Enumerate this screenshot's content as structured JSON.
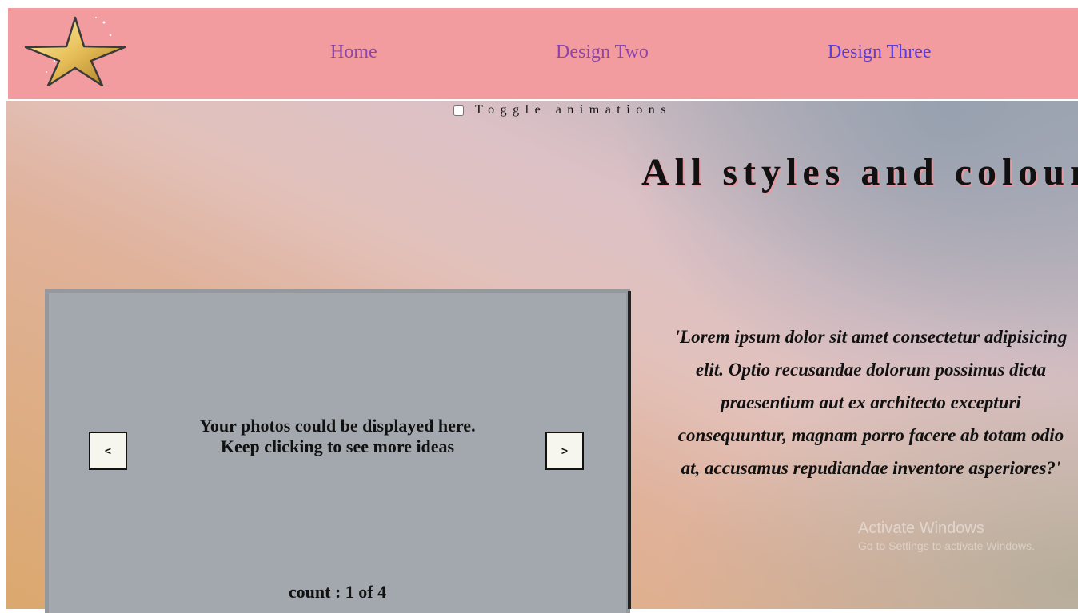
{
  "header": {
    "logo": "gold-star-logo",
    "nav": [
      {
        "label": "Home"
      },
      {
        "label": "Design Two"
      },
      {
        "label": "Design Three"
      }
    ]
  },
  "toggle": {
    "label": "Toggle animations",
    "checked": false
  },
  "headline": "All styles and colour",
  "slider": {
    "caption_line1": "Your photos could be displayed here.",
    "caption_line2": "Keep clicking to see more ideas",
    "prev_label": "<",
    "next_label": ">",
    "count": "count : 1 of 4"
  },
  "quote": "'Lorem ipsum dolor sit amet consectetur adipisicing elit. Optio recusandae dolorum possimus dicta praesentium aut ex architecto excepturi consequuntur, magnam porro facere ab totam odio at, accusamus repudiandae inventore asperiores?'",
  "watermark": {
    "line1": "Activate Windows",
    "line2": "Go to Settings to activate Windows."
  },
  "colors": {
    "header_bg": "#f39c9f",
    "nav_link": "#8e44ad",
    "nav_link_active": "#5a3be0",
    "slider_bg": "#a2a8ad"
  }
}
